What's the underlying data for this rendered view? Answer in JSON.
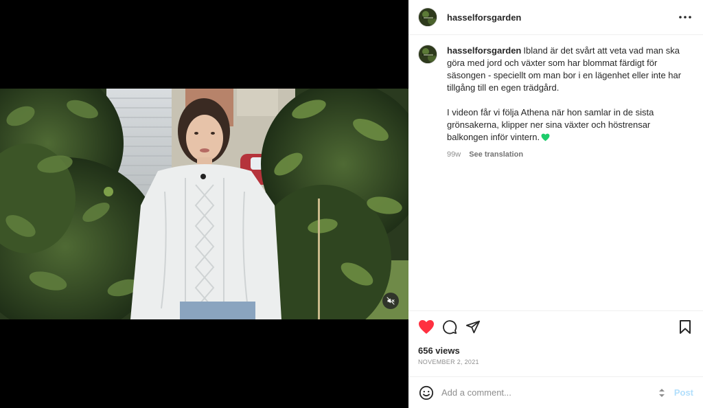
{
  "post": {
    "username": "hasselforsgarden",
    "avatar_icon": "hasselforsgarden-logo",
    "caption_paragraph_1": "Ibland är det svårt att veta vad man ska göra med jord och växter som har blommat färdigt för säsongen - speciellt om man bor i en lägenhet eller inte har tillgång till en egen trädgård.",
    "caption_paragraph_2": "I videon får vi följa Athena när hon samlar in de sista grönsakerna, klipper ner sina växter och höstrensar balkongen inför vintern.",
    "caption_emoji": "green-heart-icon",
    "age": "99w",
    "see_translation": "See translation",
    "views": "656 views",
    "date": "NOVEMBER 2, 2021"
  },
  "media": {
    "type": "video",
    "muted": true,
    "mute_icon": "speaker-muted-icon"
  },
  "actions": {
    "like_icon": "heart-filled-icon",
    "like_color": "#ff3040",
    "comment_icon": "comment-bubble-icon",
    "share_icon": "paper-plane-icon",
    "save_icon": "bookmark-icon"
  },
  "comment_box": {
    "placeholder": "Add a comment...",
    "post_label": "Post",
    "post_color": "#b2dffc",
    "emoji_icon": "smiley-icon"
  },
  "colors": {
    "text": "#262626",
    "muted": "#8e8e8e",
    "border": "#efefef",
    "green_heart": "#1dcd6b"
  }
}
